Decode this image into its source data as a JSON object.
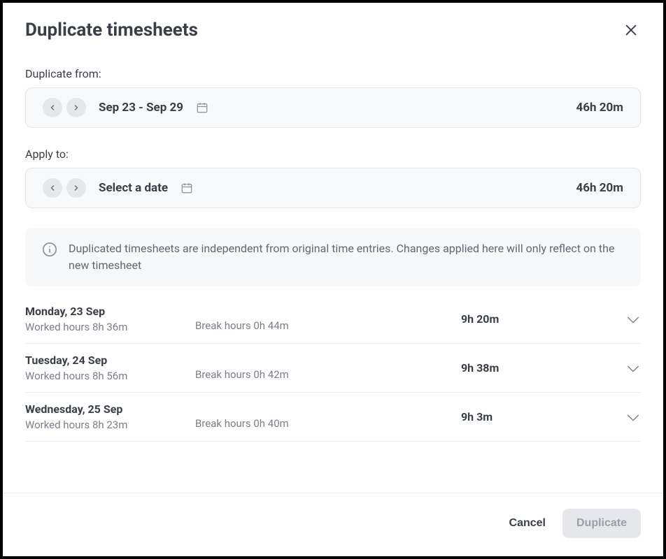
{
  "header": {
    "title": "Duplicate timesheets"
  },
  "from": {
    "label": "Duplicate from:",
    "range": "Sep 23 - Sep 29",
    "total": "46h 20m"
  },
  "apply": {
    "label": "Apply to:",
    "range": "Select a date",
    "total": "46h 20m"
  },
  "info": {
    "text": "Duplicated timesheets are independent from original time entries. Changes applied here will only reflect on the new timesheet"
  },
  "days": [
    {
      "name": "Monday, 23 Sep",
      "worked": "Worked hours 8h 36m",
      "break": "Break hours 0h 44m",
      "total": "9h 20m"
    },
    {
      "name": "Tuesday, 24 Sep",
      "worked": "Worked hours 8h 56m",
      "break": "Break hours 0h 42m",
      "total": "9h 38m"
    },
    {
      "name": "Wednesday, 25 Sep",
      "worked": "Worked hours 8h 23m",
      "break": "Break hours 0h 40m",
      "total": "9h 3m"
    }
  ],
  "footer": {
    "cancel": "Cancel",
    "duplicate": "Duplicate"
  }
}
